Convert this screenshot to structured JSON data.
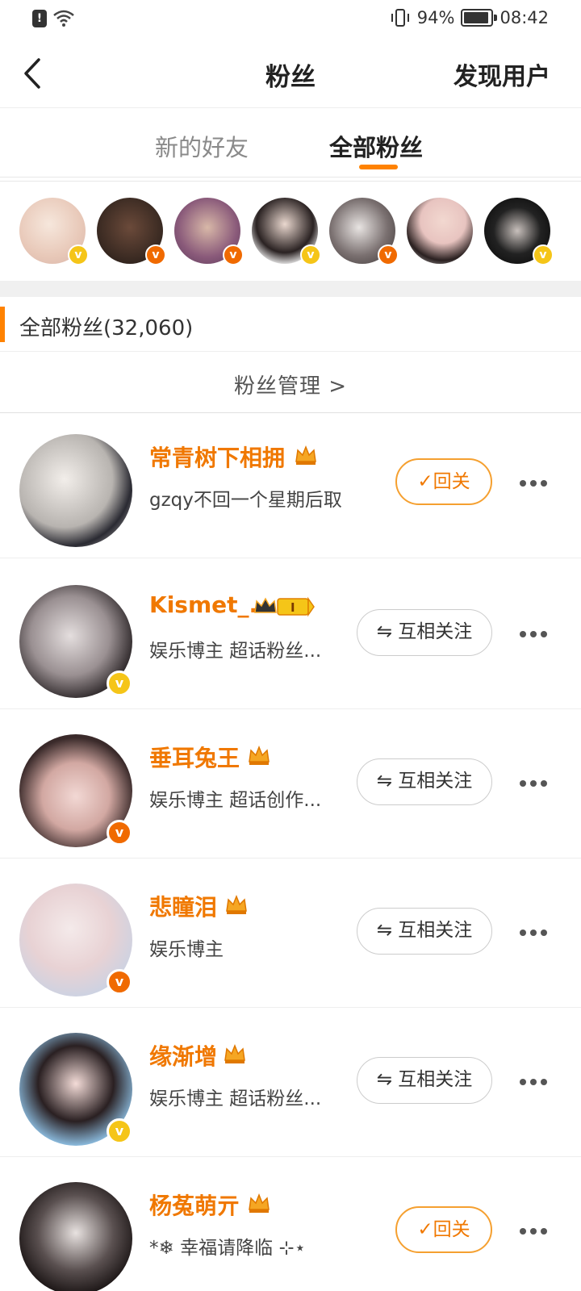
{
  "status_bar": {
    "battery": "94%",
    "battery_level": 0.94,
    "time": "08:42"
  },
  "nav": {
    "title": "粉丝",
    "right_action": "发现用户"
  },
  "tabs": [
    {
      "label": "新的好友",
      "active": false
    },
    {
      "label": "全部粉丝",
      "active": true
    }
  ],
  "section": {
    "title": "全部粉丝(32,060)",
    "manage": "粉丝管理 >"
  },
  "colors": {
    "accent": "#ff8200",
    "name": "#f07800",
    "vip_yellow": "#f5c518",
    "vip_orange": "#f06a00"
  },
  "strip_avatars": [
    {
      "badge": "yellow"
    },
    {
      "badge": "orange"
    },
    {
      "badge": "orange"
    },
    {
      "badge": "yellow"
    },
    {
      "badge": "orange"
    },
    {
      "badge": "none"
    },
    {
      "badge": "yellow"
    }
  ],
  "fans": [
    {
      "name": "常青树下相拥",
      "desc": "gzqy不回一个星期后取",
      "button": "✓回关",
      "button_type": "follow",
      "badge": "none"
    },
    {
      "name": "Kismet_...",
      "desc": "娱乐博主 超话粉丝...",
      "button": "⇋ 互相关注",
      "button_type": "mutual",
      "badge": "yellow"
    },
    {
      "name": "垂耳兔王",
      "desc": "娱乐博主 超话创作...",
      "button": "⇋ 互相关注",
      "button_type": "mutual",
      "badge": "orange"
    },
    {
      "name": "悲瞳泪",
      "desc": "娱乐博主",
      "button": "⇋ 互相关注",
      "button_type": "mutual",
      "badge": "orange"
    },
    {
      "name": "缘渐增",
      "desc": "娱乐博主 超话粉丝...",
      "button": "⇋ 互相关注",
      "button_type": "mutual",
      "badge": "yellow"
    },
    {
      "name": "杨菟萌亓",
      "desc": "*❄ 幸福请降临 ⊹⋆",
      "button": "✓回关",
      "button_type": "follow",
      "badge": "none"
    }
  ]
}
